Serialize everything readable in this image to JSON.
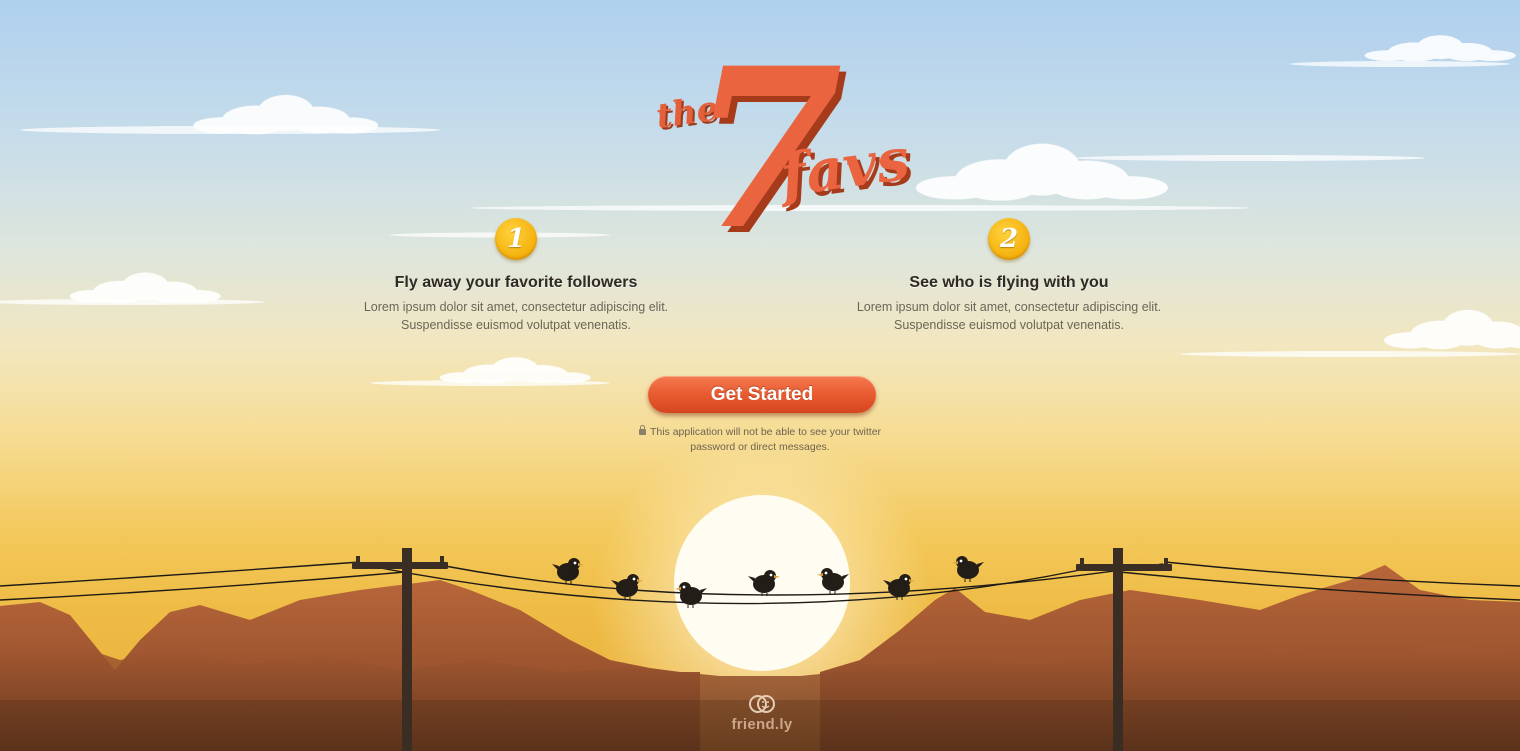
{
  "logo": {
    "small": "the",
    "number": "7",
    "word": "favs"
  },
  "steps": [
    {
      "number": "1",
      "title": "Fly away your favorite followers",
      "description": "Lorem ipsum dolor sit amet, consectetur adipiscing elit.\nSuspendisse euismod volutpat venenatis."
    },
    {
      "number": "2",
      "title": "See who is flying with you",
      "description": "Lorem ipsum dolor sit amet, consectetur adipiscing elit.\nSuspendisse euismod volutpat venenatis."
    }
  ],
  "cta": {
    "label": "Get Started"
  },
  "notice": {
    "icon": "lock-icon",
    "line1": "This application will not be able to see your twitter",
    "line2": "password or direct messages."
  },
  "footer": {
    "brand": "friend.ly",
    "icon": "friendly-logo-icon"
  },
  "colors": {
    "accent": "#e85a30",
    "badge": "#f5b20f",
    "mountain": "#9c5a30"
  }
}
